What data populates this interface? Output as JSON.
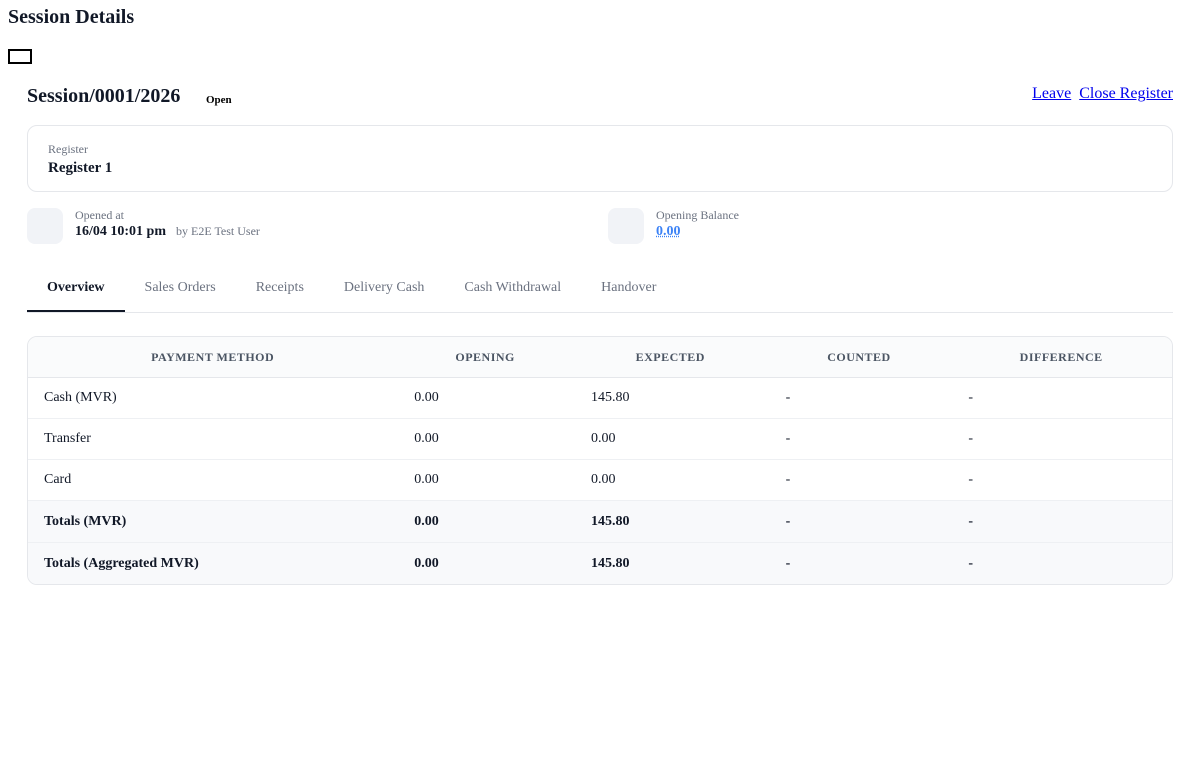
{
  "page": {
    "title": "Session Details"
  },
  "session": {
    "title": "Session/0001/2026",
    "status": "Open",
    "actions": {
      "leave": "Leave",
      "close_register": "Close Register"
    }
  },
  "register": {
    "label": "Register",
    "name": "Register 1"
  },
  "opened": {
    "label": "Opened at",
    "value": "16/04 10:01 pm",
    "by": "by E2E Test User"
  },
  "balance": {
    "label": "Opening Balance",
    "value": "0.00"
  },
  "tabs": [
    "Overview",
    "Sales Orders",
    "Receipts",
    "Delivery Cash",
    "Cash Withdrawal",
    "Handover"
  ],
  "active_tab": "Overview",
  "table": {
    "headers": {
      "method": "PAYMENT METHOD",
      "opening": "OPENING",
      "expected": "EXPECTED",
      "counted": "COUNTED",
      "difference": "DIFFERENCE"
    },
    "rows": [
      {
        "method": "Cash (MVR)",
        "opening": "0.00",
        "expected": "145.80",
        "counted": "-",
        "difference": "-"
      },
      {
        "method": "Transfer",
        "opening": "0.00",
        "expected": "0.00",
        "counted": "-",
        "difference": "-"
      },
      {
        "method": "Card",
        "opening": "0.00",
        "expected": "0.00",
        "counted": "-",
        "difference": "-"
      }
    ],
    "totals": [
      {
        "method": "Totals (MVR)",
        "opening": "0.00",
        "expected": "145.80",
        "counted": "-",
        "difference": "-"
      },
      {
        "method": "Totals (Aggregated MVR)",
        "opening": "0.00",
        "expected": "145.80",
        "counted": "-",
        "difference": "-"
      }
    ]
  },
  "colors": {
    "accent": "#3b82f6",
    "border": "#e5e7eb",
    "muted": "#6b7280"
  }
}
